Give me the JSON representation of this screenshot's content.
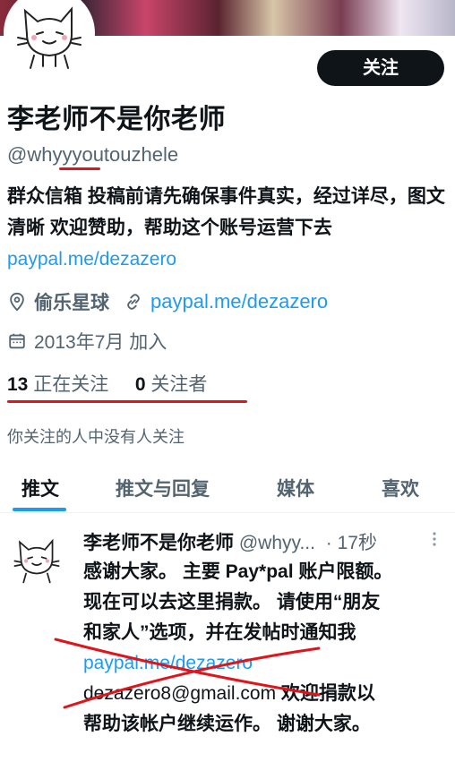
{
  "profile": {
    "name": "李老师不是你老师",
    "handle": "@whyyyoutouzhele",
    "follow_label": "关注",
    "bio_text": "群众信箱 投稿前请先确保事件真实，经过详尽，图文清晰 欢迎赞助，帮助这个账号运营下去",
    "bio_link": "paypal.me/dezazero",
    "location": "偷乐星球",
    "website": "paypal.me/dezazero",
    "joined": "2013年7月 加入",
    "following_count": "13",
    "following_label": "正在关注",
    "followers_count": "0",
    "followers_label": "关注者",
    "followed_by_note": "你关注的人中没有人关注"
  },
  "tabs": [
    {
      "label": "推文",
      "active": true
    },
    {
      "label": "推文与回复",
      "active": false
    },
    {
      "label": "媒体",
      "active": false
    },
    {
      "label": "喜欢",
      "active": false
    }
  ],
  "tweet": {
    "author_name": "李老师不是你老师",
    "author_handle": "@whyy...",
    "time": "· 17秒",
    "line1": "感谢大家。 主要 Pay*pal 账户限额。",
    "line2": "现在可以去这里捐款。 请使用“朋友",
    "line3": "和家人”选项，并在发帖时通知我",
    "link": "paypal.me/dezazero",
    "email": "dezazero8@gmail.com",
    "line5_tail": " 欢迎捐款以",
    "line6": "帮助该帐户继续运作。 谢谢大家。"
  },
  "colors": {
    "link": "#1d9bf0",
    "annotation_red": "#e0151b",
    "text_secondary": "#536471",
    "button_bg": "#0f1419"
  },
  "icons": [
    "location-icon",
    "link-icon",
    "calendar-icon",
    "more-icon"
  ]
}
